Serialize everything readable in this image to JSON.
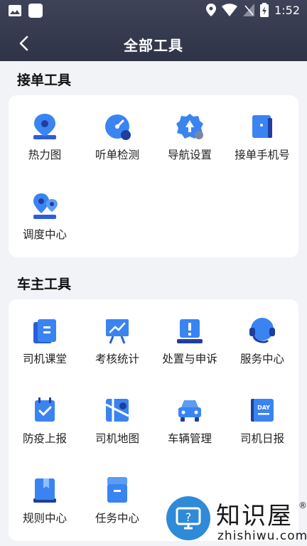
{
  "status_bar": {
    "time": "1:52"
  },
  "header": {
    "title": "全部工具"
  },
  "sections": [
    {
      "title": "接单工具",
      "tools": [
        {
          "label": "热力图",
          "icon": "location-pin-icon"
        },
        {
          "label": "听单检测",
          "icon": "gauge-icon"
        },
        {
          "label": "导航设置",
          "icon": "navigation-gear-icon"
        },
        {
          "label": "接单手机号",
          "icon": "phone-book-icon"
        },
        {
          "label": "调度中心",
          "icon": "dispatch-pins-icon"
        }
      ]
    },
    {
      "title": "车主工具",
      "tools": [
        {
          "label": "司机课堂",
          "icon": "classroom-icon"
        },
        {
          "label": "考核统计",
          "icon": "statistics-board-icon"
        },
        {
          "label": "处置与申诉",
          "icon": "appeal-icon"
        },
        {
          "label": "服务中心",
          "icon": "headset-icon"
        },
        {
          "label": "防疫上报",
          "icon": "calendar-check-icon"
        },
        {
          "label": "司机地图",
          "icon": "map-icon"
        },
        {
          "label": "车辆管理",
          "icon": "car-icon"
        },
        {
          "label": "司机日报",
          "icon": "daily-report-icon"
        },
        {
          "label": "规则中心",
          "icon": "rule-book-icon"
        },
        {
          "label": "任务中心",
          "icon": "task-box-icon"
        }
      ]
    }
  ],
  "watermark": {
    "title": "知识屋",
    "url": "zhishiwu.com",
    "reg": "®"
  },
  "colors": {
    "header": "#363a4f",
    "accent": "#2a6ff0",
    "icon_light": "#8fc0ff"
  }
}
